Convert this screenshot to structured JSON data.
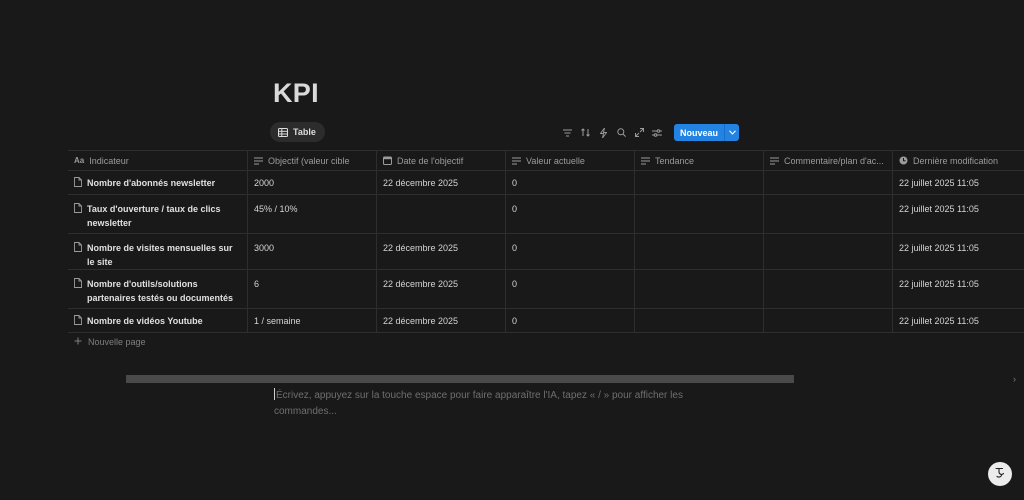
{
  "page": {
    "title": "KPI"
  },
  "view": {
    "tab_label": "Table"
  },
  "toolbar": {
    "icons": [
      "filter-icon",
      "sort-icon",
      "automation-icon",
      "search-icon",
      "expand-icon",
      "settings-icon"
    ],
    "new_label": "Nouveau",
    "accent": "#2383e2"
  },
  "table": {
    "columns": [
      {
        "label": "Indicateur",
        "icon": "title-icon"
      },
      {
        "label": "Objectif (valeur cible",
        "icon": "text-icon"
      },
      {
        "label": "Date de l'objectif",
        "icon": "calendar-icon"
      },
      {
        "label": "Valeur actuelle",
        "icon": "text-icon"
      },
      {
        "label": "Tendance",
        "icon": "text-icon"
      },
      {
        "label": "Commentaire/plan d'ac...",
        "icon": "text-icon"
      },
      {
        "label": "Dernière modification",
        "icon": "clock-icon"
      }
    ],
    "rows": [
      {
        "indicateur": "Nombre d'abonnés newsletter",
        "objectif": "2000",
        "date": "22 décembre 2025",
        "valeur": "0",
        "tendance": "",
        "commentaire": "",
        "modif": "22 juillet 2025 11:05"
      },
      {
        "indicateur": "Taux d'ouverture / taux de clics newsletter",
        "objectif": "45% / 10%",
        "date": "",
        "valeur": "0",
        "tendance": "",
        "commentaire": "",
        "modif": "22 juillet 2025 11:05"
      },
      {
        "indicateur": "Nombre de visites mensuelles sur le site",
        "objectif": "3000",
        "date": "22 décembre 2025",
        "valeur": "0",
        "tendance": "",
        "commentaire": "",
        "modif": "22 juillet 2025 11:05"
      },
      {
        "indicateur": "Nombre d'outils/solutions partenaires testés ou documentés",
        "objectif": "6",
        "date": "22 décembre 2025",
        "valeur": "0",
        "tendance": "",
        "commentaire": "",
        "modif": "22 juillet 2025 11:05"
      },
      {
        "indicateur": "Nombre de vidéos Youtube",
        "objectif": "1 / semaine",
        "date": "22 décembre 2025",
        "valeur": "0",
        "tendance": "",
        "commentaire": "",
        "modif": "22 juillet 2025 11:05"
      }
    ],
    "new_row_label": "Nouvelle page"
  },
  "editor": {
    "placeholder": "Écrivez, appuyez sur la touche espace pour faire apparaître l'IA, tapez « / » pour afficher les commandes..."
  },
  "help": {
    "label": "?"
  }
}
